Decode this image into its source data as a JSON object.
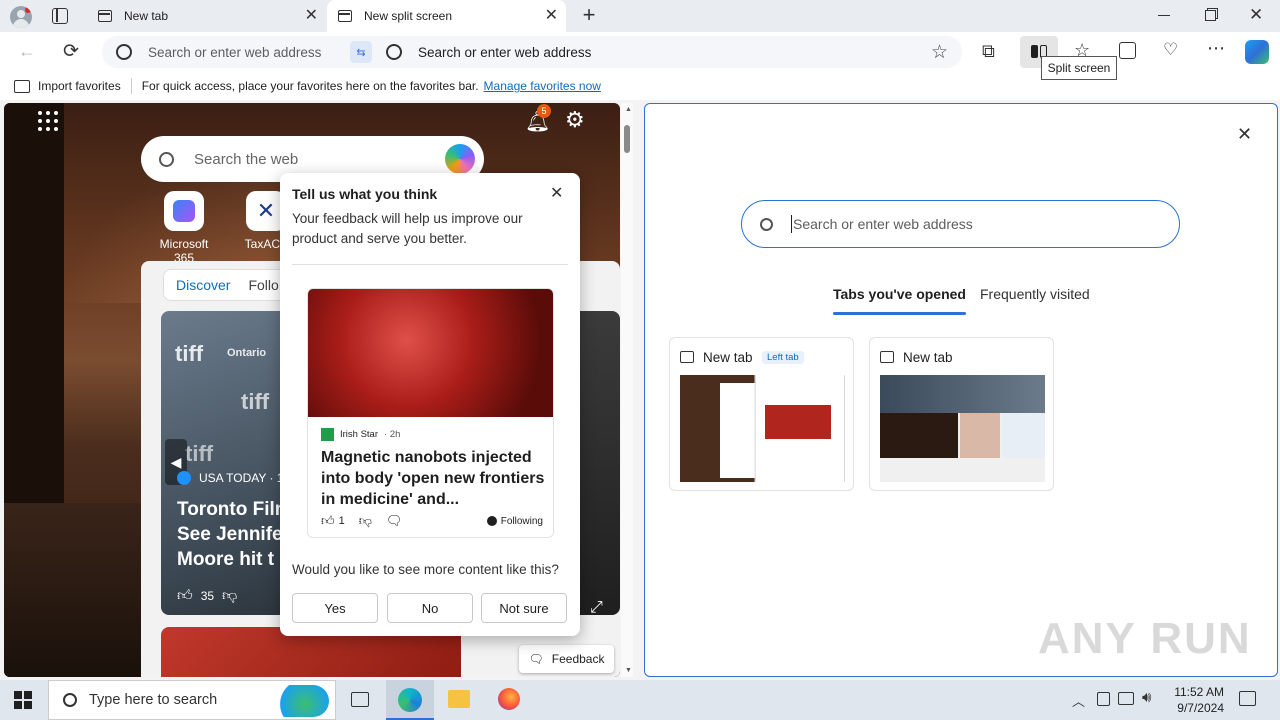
{
  "tabs": [
    {
      "label": "New tab"
    },
    {
      "label": "New split screen"
    }
  ],
  "address": {
    "left_placeholder": "Search or enter web address",
    "right_placeholder": "Search or enter web address"
  },
  "tooltip": "Split screen",
  "favorites_bar": {
    "import_label": "Import favorites",
    "message": "For quick access, place your favorites here on the favorites bar.",
    "link": "Manage favorites now"
  },
  "left_pane": {
    "search_placeholder": "Search the web",
    "notification_count": "5",
    "shortcuts": [
      {
        "label": "Microsoft 365"
      },
      {
        "label": "TaxACT"
      }
    ],
    "feed_tabs": [
      "Discover",
      "Follo"
    ],
    "story": {
      "source": "USA TODAY · 1",
      "headline": "Toronto Film\nSee Jennife\nMoore hit t",
      "likes": "35"
    },
    "feedback_button": "Feedback"
  },
  "feedback_popup": {
    "title": "Tell us what you think",
    "body": "Your feedback will help us improve our product and serve you better.",
    "article": {
      "source": "Irish Star",
      "time": "· 2h",
      "headline": "Magnetic nanobots injected into body 'open new frontiers in medicine' and...",
      "likes": "1",
      "following": "Following"
    },
    "question": "Would you like to see more content like this?",
    "options": [
      "Yes",
      "No",
      "Not sure"
    ]
  },
  "right_pane": {
    "search_placeholder": "Search or enter web address",
    "tabs": [
      "Tabs you've opened",
      "Frequently visited"
    ],
    "cards": [
      {
        "title": "New tab",
        "badge": "Left tab"
      },
      {
        "title": "New tab",
        "badge": ""
      }
    ]
  },
  "watermark": "ANY RUN",
  "taskbar": {
    "search_placeholder": "Type here to search",
    "time": "11:52 AM",
    "date": "9/7/2024"
  },
  "colors": {
    "accent": "#2f6fd6",
    "link": "#0f6cbd",
    "notification": "#e8590c"
  }
}
